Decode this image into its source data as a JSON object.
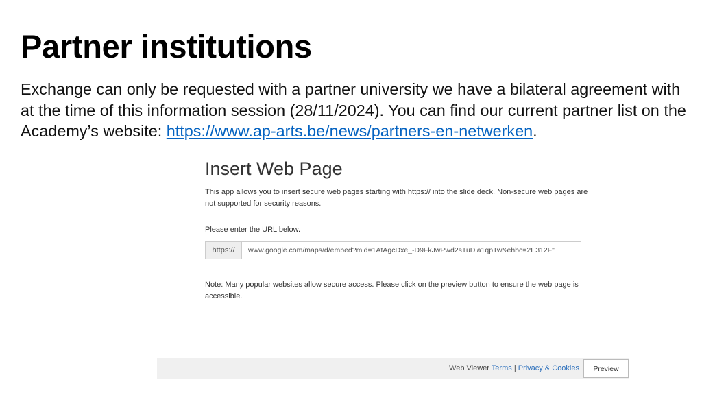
{
  "slide": {
    "title": "Partner institutions",
    "body_text": "Exchange can only be requested with a partner university we have a bilateral agreement with at the time of this information session (28/11/2024). You can find our current partner list on the Academy’s website: ",
    "link_text": "https://www.ap-arts.be/news/partners-en-netwerken",
    "body_end": "."
  },
  "dialog": {
    "title": "Insert Web Page",
    "description": "This app allows you to insert secure web pages starting with https:// into the slide deck. Non-secure web pages are not supported for security reasons.",
    "prompt": "Please enter the URL below.",
    "url_prefix": "https://",
    "url_value": "www.google.com/maps/d/embed?mid=1AtAgcDxe_-D9FkJwPwd2sTuDia1qpTw&ehbc=2E312F\"",
    "note": "Note: Many popular websites allow secure access. Please click on the preview button to ensure the web page is accessible."
  },
  "footer": {
    "web_viewer_label": "Web Viewer",
    "terms_link": "Terms",
    "separator": "|",
    "privacy_link": "Privacy & Cookies",
    "preview_button": "Preview"
  }
}
